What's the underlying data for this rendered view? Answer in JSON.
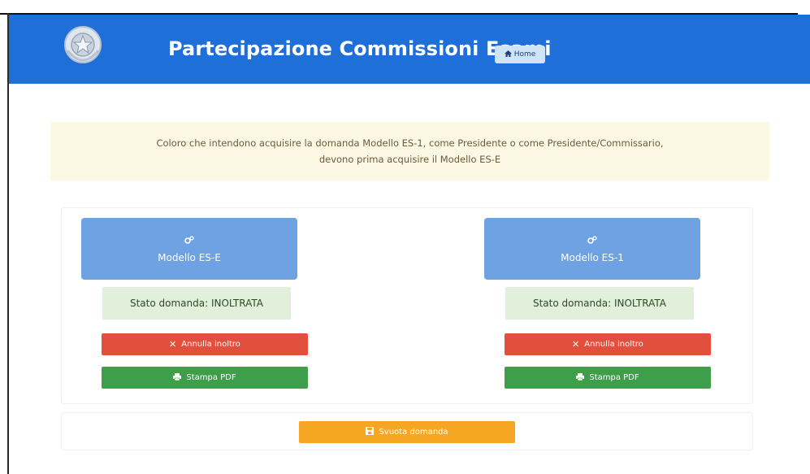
{
  "header": {
    "title": "Partecipazione Commissioni Esami",
    "home_label": "Home"
  },
  "notice": {
    "line1": "Coloro che intendono acquisire la domanda Modello ES-1, come Presidente o come Presidente/Commissario,",
    "line2": "devono prima acquisire il Modello ES-E"
  },
  "cards": [
    {
      "model_label": "Modello ES-E",
      "status_text": "Stato domanda: INOLTRATA",
      "cancel_label": "Annulla inoltro",
      "print_label": "Stampa PDF"
    },
    {
      "model_label": "Modello ES-1",
      "status_text": "Stato domanda: INOLTRATA",
      "cancel_label": "Annulla inoltro",
      "print_label": "Stampa PDF"
    }
  ],
  "footer": {
    "reset_label": "Svuota domanda"
  },
  "colors": {
    "header": "#1e6fd8",
    "card": "#6ea2e2",
    "status": "#e1efdb",
    "cancel": "#e34f3d",
    "print": "#3e9e49",
    "reset": "#f5a623"
  },
  "icons": {
    "emblem": "italian-republic-emblem",
    "home": "home-icon",
    "cog": "cogs-icon",
    "cancel": "close-icon",
    "print": "print-icon",
    "reset": "eraser-icon"
  }
}
